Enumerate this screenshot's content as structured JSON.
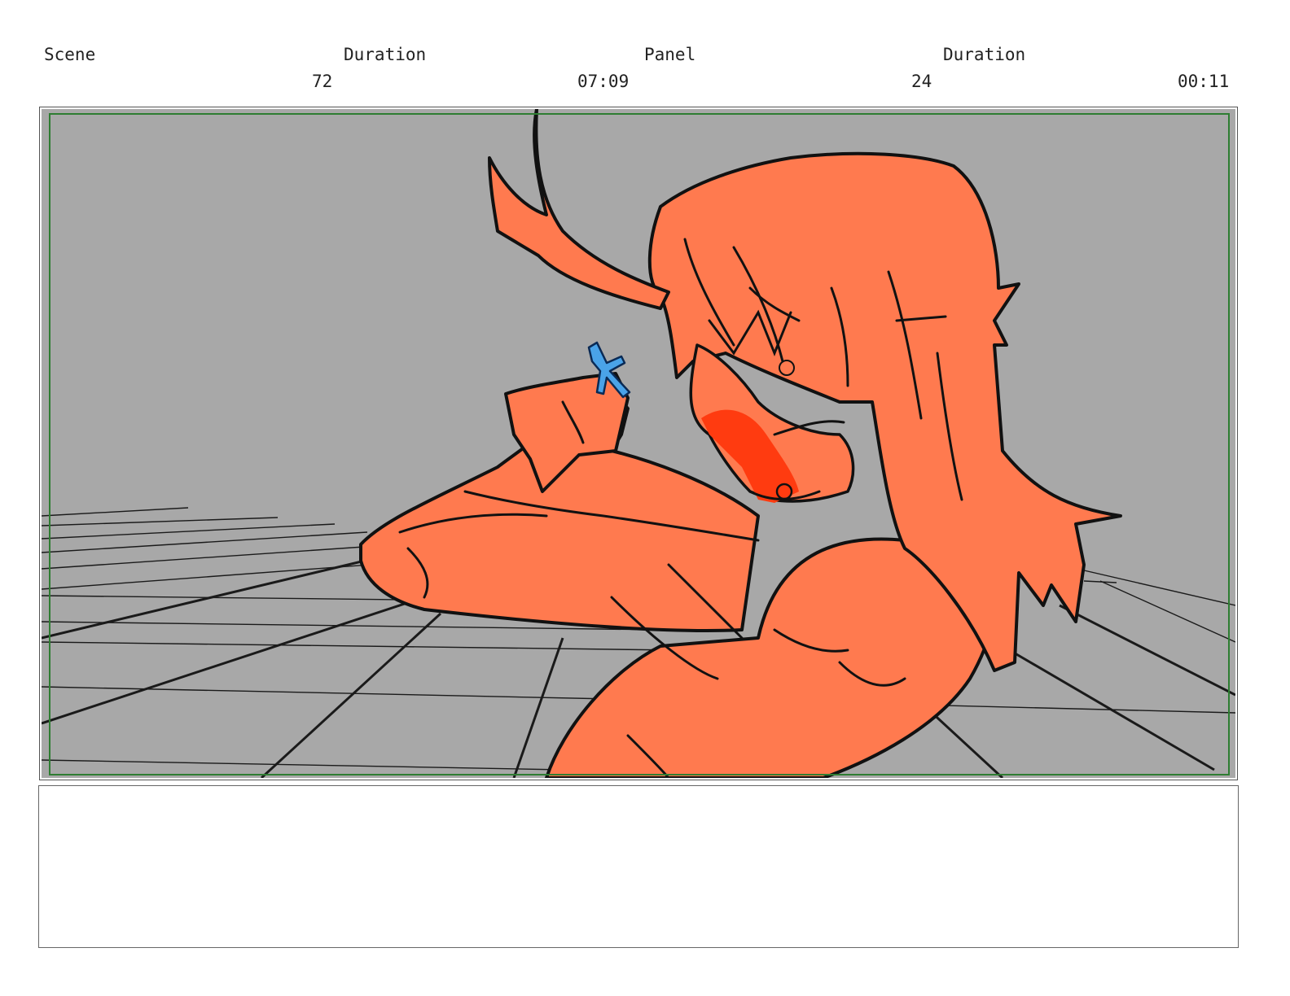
{
  "header": {
    "scene_label": "Scene",
    "scene_duration_label": "Duration",
    "panel_label": "Panel",
    "panel_duration_label": "Duration",
    "scene_number": "72",
    "scene_duration": "07:09",
    "panel_number": "24",
    "panel_duration": "00:11"
  },
  "colors": {
    "background": "#a8a8a8",
    "skin": "#ff7a4f",
    "nose": "#ff3b10",
    "prop": "#4aa3e8",
    "safe_frame": "#2e7d32"
  },
  "notes": {
    "text": ""
  }
}
